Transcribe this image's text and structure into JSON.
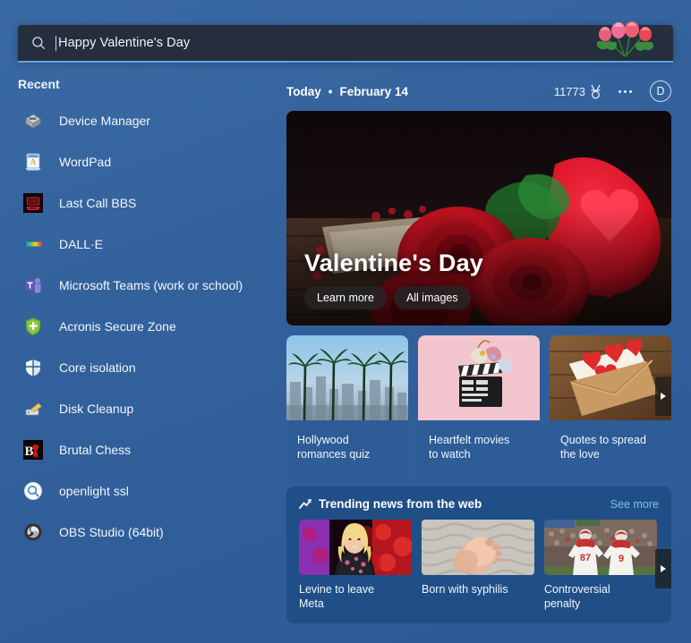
{
  "search": {
    "value": "Happy Valentine's Day",
    "icon": "search-icon",
    "decoration_icon": "tulip-bouquet-icon"
  },
  "sidebar": {
    "heading": "Recent",
    "items": [
      {
        "label": "Device Manager",
        "icon": "device-manager-icon"
      },
      {
        "label": "WordPad",
        "icon": "wordpad-icon"
      },
      {
        "label": "Last Call BBS",
        "icon": "last-call-bbs-icon"
      },
      {
        "label": "DALL·E",
        "icon": "dalle-icon"
      },
      {
        "label": "Microsoft Teams (work or school)",
        "icon": "microsoft-teams-icon"
      },
      {
        "label": "Acronis Secure Zone",
        "icon": "acronis-shield-icon"
      },
      {
        "label": "Core isolation",
        "icon": "core-isolation-shield-icon"
      },
      {
        "label": "Disk Cleanup",
        "icon": "disk-cleanup-icon"
      },
      {
        "label": "Brutal Chess",
        "icon": "brutal-chess-icon"
      },
      {
        "label": "openlight ssl",
        "icon": "openlight-ssl-icon"
      },
      {
        "label": "OBS Studio (64bit)",
        "icon": "obs-studio-icon"
      }
    ]
  },
  "header": {
    "today": "Today",
    "separator": "•",
    "date": "February 14",
    "points": "11773",
    "points_icon": "rewards-medal-icon",
    "more_icon": "ellipsis-icon",
    "avatar_initial": "D"
  },
  "hero": {
    "title": "Valentine's Day",
    "learn_more": "Learn more",
    "all_images": "All images",
    "image_alt": "red-roses-hero-image"
  },
  "cards": [
    {
      "caption": "Hollywood\nromances quiz",
      "image": "palm-trees-skyline-image"
    },
    {
      "caption": "Heartfelt movies\nto watch",
      "image": "clapperboard-image"
    },
    {
      "caption": "Quotes to spread\nthe love",
      "image": "envelope-hearts-image"
    }
  ],
  "trending": {
    "icon": "trending-up-icon",
    "title": "Trending news from the web",
    "see_more": "See more",
    "articles": [
      {
        "caption": "Levine to leave\nMeta",
        "image": "woman-presenter-image"
      },
      {
        "caption": "Born with syphilis",
        "image": "baby-feet-image"
      },
      {
        "caption": "Controversial\npenalty",
        "image": "football-players-image"
      }
    ]
  },
  "colors": {
    "background": "#33619c",
    "search_background": "#242e3d",
    "search_accent": "#5fa5e0",
    "card_background": "#2d5c97",
    "trending_background": "#204f87",
    "link": "#7cc0f2"
  }
}
